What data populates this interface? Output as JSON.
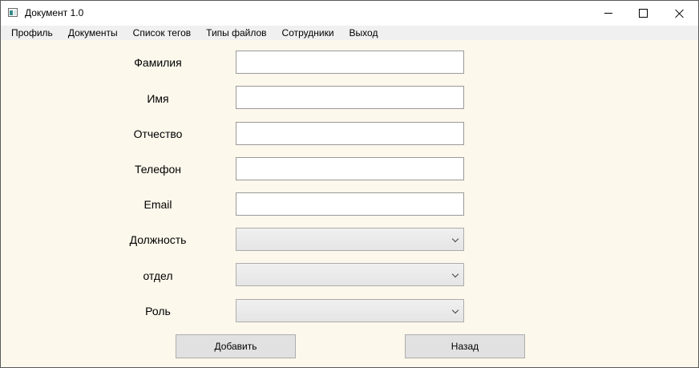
{
  "window": {
    "title": "Документ 1.0",
    "icon": "app-window-icon",
    "controls": [
      "minimize-icon",
      "maximize-icon",
      "close-icon"
    ]
  },
  "menu": {
    "items": [
      {
        "label": "Профиль"
      },
      {
        "label": "Документы"
      },
      {
        "label": "Список тегов"
      },
      {
        "label": "Типы файлов"
      },
      {
        "label": "Сотрудники"
      },
      {
        "label": "Выход"
      }
    ]
  },
  "form": {
    "fields": [
      {
        "label": "Фамилия",
        "type": "text",
        "value": ""
      },
      {
        "label": "Имя",
        "type": "text",
        "value": ""
      },
      {
        "label": "Отчество",
        "type": "text",
        "value": ""
      },
      {
        "label": "Телефон",
        "type": "text",
        "value": ""
      },
      {
        "label": "Email",
        "type": "text",
        "value": ""
      },
      {
        "label": "Должность",
        "type": "select",
        "value": ""
      },
      {
        "label": "отдел",
        "type": "select",
        "value": ""
      },
      {
        "label": "Роль",
        "type": "select",
        "value": ""
      }
    ]
  },
  "buttons": {
    "add_label": "Добавить",
    "back_label": "Назад"
  },
  "colors": {
    "form_background": "#fdf8ec",
    "menubar_background": "#f0f0f0",
    "button_background": "#e1e1e1"
  }
}
